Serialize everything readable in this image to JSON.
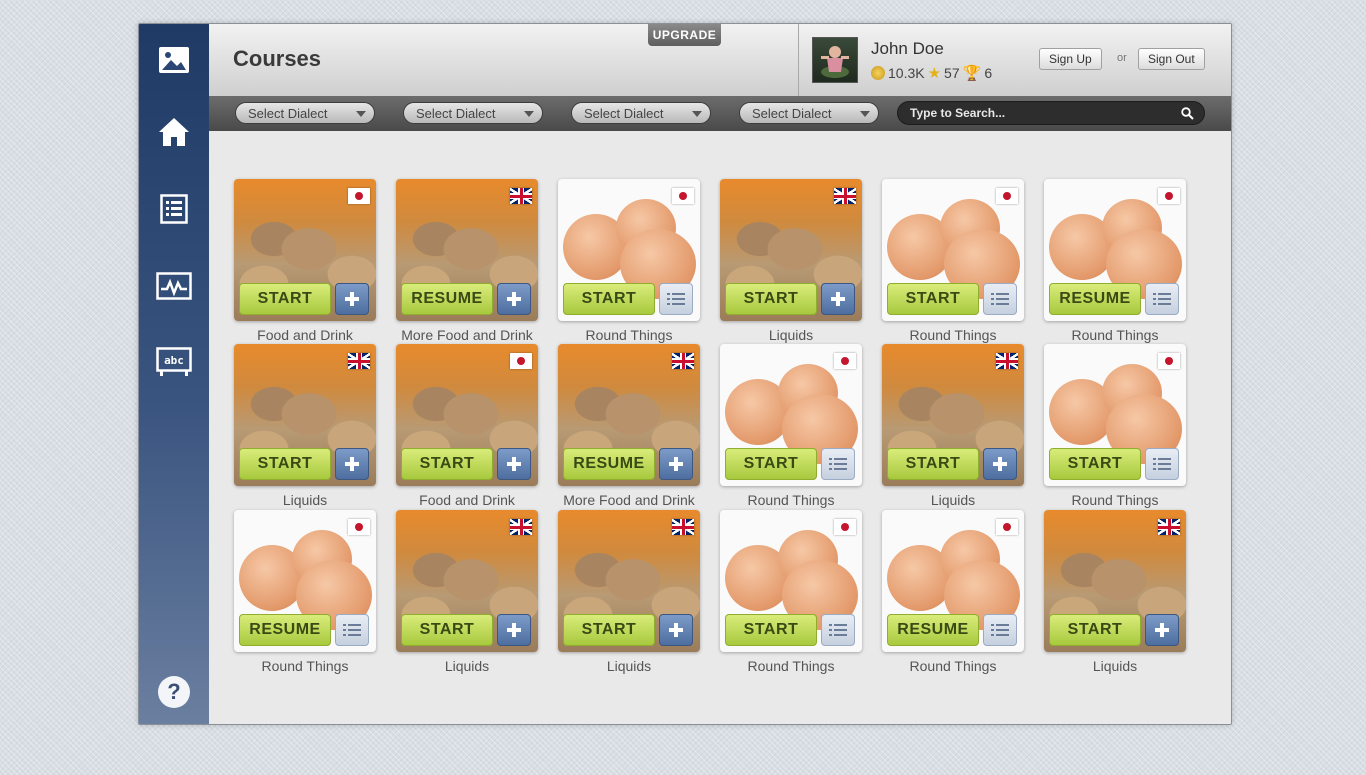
{
  "header": {
    "title": "Courses",
    "upgrade_label": "UPGRADE",
    "user": {
      "name": "John Doe",
      "coins": "10.3K",
      "stars": "57",
      "trophies": "6"
    },
    "sign_up_label": "Sign Up",
    "or_label": "or",
    "sign_out_label": "Sign Out"
  },
  "sidebar": {
    "items": [
      {
        "icon": "image-icon"
      },
      {
        "icon": "home-icon"
      },
      {
        "icon": "list-icon"
      },
      {
        "icon": "chart-icon"
      },
      {
        "icon": "abc-board-icon"
      }
    ],
    "help_label": "?"
  },
  "toolbar": {
    "dialects": [
      "Select Dialect",
      "Select Dialect",
      "Select Dialect",
      "Select Dialect"
    ],
    "search_placeholder": "Type to Search..."
  },
  "colors": {
    "sidebar": "#2b4675",
    "action_green": "#bcd856",
    "add_blue": "#5b7bab"
  },
  "courses": [
    [
      {
        "title": "Food and Drink",
        "action": "START",
        "image": "bread",
        "flag": "jp",
        "secondary": "add"
      },
      {
        "title": "More Food and Drink",
        "action": "RESUME",
        "image": "bread",
        "flag": "uk",
        "secondary": "add"
      },
      {
        "title": "Round Things",
        "action": "START",
        "image": "eggs",
        "flag": "jp",
        "secondary": "list"
      },
      {
        "title": "Liquids",
        "action": "START",
        "image": "bread",
        "flag": "uk",
        "secondary": "add"
      },
      {
        "title": "Round Things",
        "action": "START",
        "image": "eggs",
        "flag": "jp",
        "secondary": "list"
      },
      {
        "title": "Round Things",
        "action": "RESUME",
        "image": "eggs",
        "flag": "jp",
        "secondary": "list"
      }
    ],
    [
      {
        "title": "Liquids",
        "action": "START",
        "image": "bread",
        "flag": "uk",
        "secondary": "add"
      },
      {
        "title": "Food and Drink",
        "action": "START",
        "image": "bread",
        "flag": "jp",
        "secondary": "add"
      },
      {
        "title": "More Food and Drink",
        "action": "RESUME",
        "image": "bread",
        "flag": "uk",
        "secondary": "add"
      },
      {
        "title": "Round Things",
        "action": "START",
        "image": "eggs",
        "flag": "jp",
        "secondary": "list"
      },
      {
        "title": "Liquids",
        "action": "START",
        "image": "bread",
        "flag": "uk",
        "secondary": "add"
      },
      {
        "title": "Round Things",
        "action": "START",
        "image": "eggs",
        "flag": "jp",
        "secondary": "list"
      }
    ],
    [
      {
        "title": "Round Things",
        "action": "RESUME",
        "image": "eggs",
        "flag": "jp",
        "secondary": "list"
      },
      {
        "title": "Liquids",
        "action": "START",
        "image": "bread",
        "flag": "uk",
        "secondary": "add"
      },
      {
        "title": "Liquids",
        "action": "START",
        "image": "bread",
        "flag": "uk",
        "secondary": "add"
      },
      {
        "title": "Round Things",
        "action": "START",
        "image": "eggs",
        "flag": "jp",
        "secondary": "list"
      },
      {
        "title": "Round Things",
        "action": "RESUME",
        "image": "eggs",
        "flag": "jp",
        "secondary": "list"
      },
      {
        "title": "Liquids",
        "action": "START",
        "image": "bread",
        "flag": "uk",
        "secondary": "add"
      }
    ]
  ]
}
